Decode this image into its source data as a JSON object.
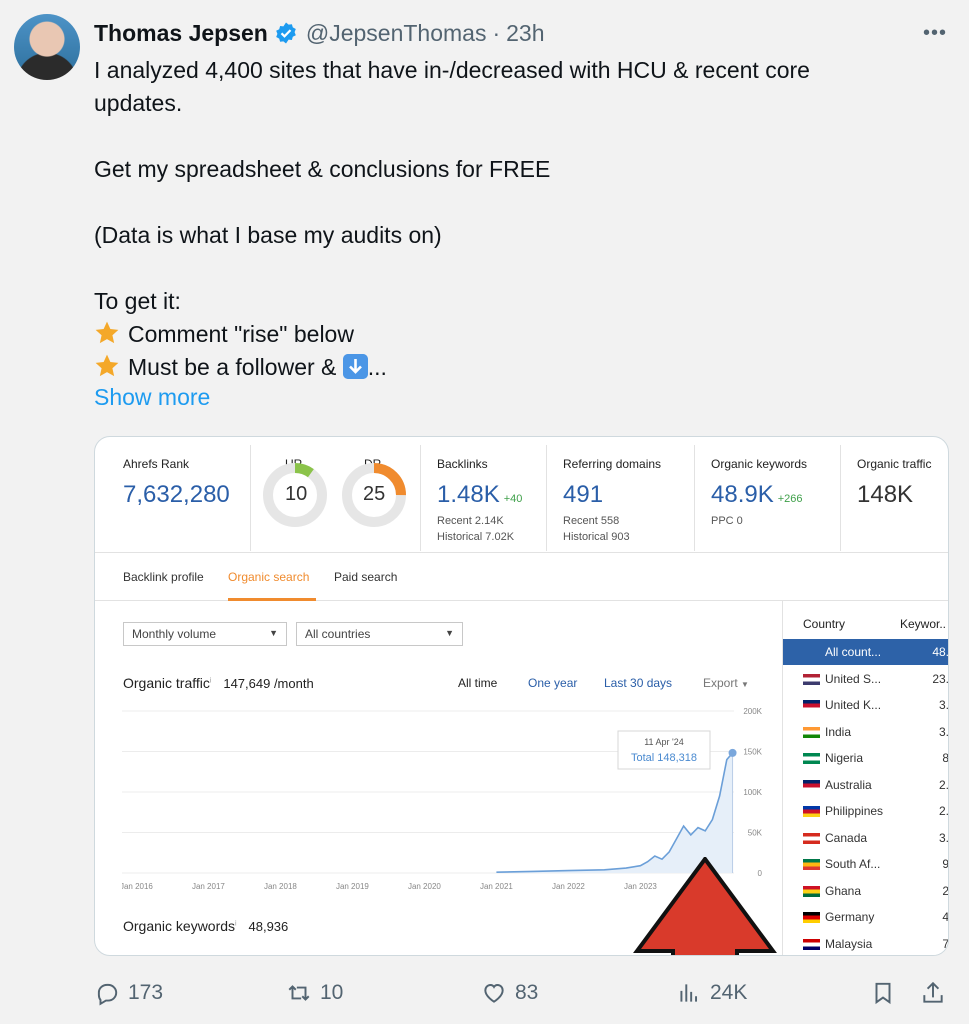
{
  "tweet": {
    "author_name": "Thomas Jepsen",
    "handle": "@JepsenThomas",
    "separator": "·",
    "time": "23h",
    "more_label": "•••",
    "lines": [
      "I analyzed 4,400 sites that have in-/decreased with HCU & recent core",
      "updates.",
      "",
      "Get my spreadsheet & conclusions for FREE",
      "",
      "(Data is what I base my audits on)",
      "",
      "To get it:"
    ],
    "bullet_1": "Comment \"rise\" below",
    "bullet_2_prefix": "Must be a follower & ",
    "bullet_2_suffix": "...",
    "show_more": "Show more"
  },
  "metrics": {
    "ahrefs_rank_label": "Ahrefs Rank",
    "ahrefs_rank": "7,632,280",
    "ur_label": "UR",
    "ur": "10",
    "dr_label": "DR",
    "dr": "25",
    "backlinks_label": "Backlinks",
    "backlinks": "1.48K",
    "backlinks_delta": "+40",
    "backlinks_recent": "Recent 2.14K",
    "backlinks_historical": "Historical 7.02K",
    "refdomains_label": "Referring domains",
    "refdomains": "491",
    "refdomains_recent": "Recent 558",
    "refdomains_historical": "Historical 903",
    "organic_keywords_label": "Organic keywords",
    "organic_keywords": "48.9K",
    "organic_keywords_delta": "+266",
    "ppc": "PPC 0",
    "organic_traffic_label": "Organic traffic",
    "organic_traffic": "148K"
  },
  "gauges": {
    "ur_fraction": 0.1,
    "dr_fraction": 0.25,
    "ur_color": "#8bc34a",
    "dr_color": "#f08b2e"
  },
  "tabs": [
    "Backlink profile",
    "Organic search",
    "Paid search"
  ],
  "filters": {
    "volume": "Monthly volume",
    "countries": "All countries"
  },
  "chart_header": {
    "title": "Organic traffic",
    "value": "147,649 /month",
    "ranges": [
      "All time",
      "One year",
      "Last 30 days"
    ],
    "export": "Export"
  },
  "tooltip": {
    "date": "11 Apr '24",
    "total": "Total 148,318"
  },
  "keywords_footer": {
    "title": "Organic keywords",
    "value": "48,936"
  },
  "chart_data": {
    "type": "area",
    "title": "Organic traffic",
    "x_ticks": [
      "Jan 2016",
      "Jan 2017",
      "Jan 2018",
      "Jan 2019",
      "Jan 2020",
      "Jan 2021",
      "Jan 2022",
      "Jan 2023"
    ],
    "y_ticks": [
      "200K",
      "150K",
      "100K",
      "50K",
      "0"
    ],
    "ylim": [
      0,
      200000
    ],
    "x": [
      2021.0,
      2021.5,
      2022.0,
      2022.5,
      2022.8,
      2023.0,
      2023.1,
      2023.2,
      2023.3,
      2023.4,
      2023.5,
      2023.6,
      2023.7,
      2023.8,
      2023.9,
      2024.0,
      2024.1,
      2024.2,
      2024.28
    ],
    "values": [
      1000,
      2000,
      3000,
      4000,
      6000,
      9000,
      14000,
      21000,
      17000,
      26000,
      42000,
      58000,
      47000,
      56000,
      52000,
      66000,
      95000,
      140000,
      148318
    ],
    "series_color": "#6b9fd8"
  },
  "countries": {
    "header_country": "Country",
    "header_keywords": "Keywor..",
    "rows": [
      {
        "name": "All count...",
        "value": "48."
      },
      {
        "name": "United S...",
        "value": "23."
      },
      {
        "name": "United K...",
        "value": "3."
      },
      {
        "name": "India",
        "value": "3."
      },
      {
        "name": "Nigeria",
        "value": "8"
      },
      {
        "name": "Australia",
        "value": "2."
      },
      {
        "name": "Philippines",
        "value": "2."
      },
      {
        "name": "Canada",
        "value": "3."
      },
      {
        "name": "South Af...",
        "value": "9"
      },
      {
        "name": "Ghana",
        "value": "2"
      },
      {
        "name": "Germany",
        "value": "4"
      },
      {
        "name": "Malaysia",
        "value": "7"
      }
    ]
  },
  "annotation": {
    "arrow_color": "#d93a2b"
  },
  "actions": {
    "replies": "173",
    "reposts": "10",
    "likes": "83",
    "views": "24K"
  }
}
